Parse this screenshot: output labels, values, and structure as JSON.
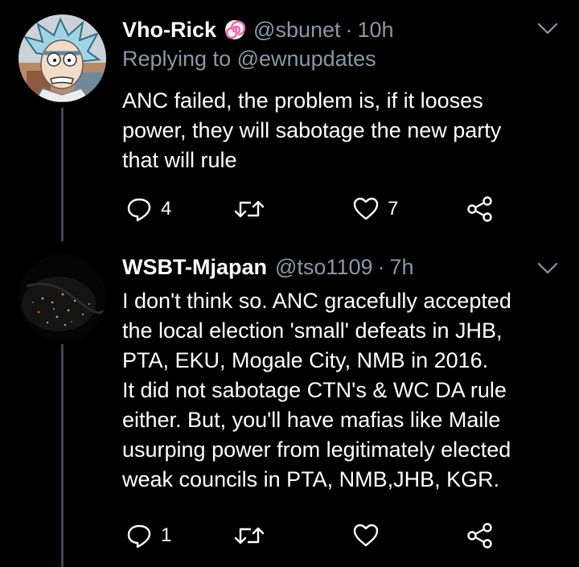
{
  "tweets": [
    {
      "display_name": "Vho-Rick",
      "handle": "@sbunet",
      "separator": "·",
      "time": "10h",
      "verified_badge_icon": "swirl-candy-emoji-icon",
      "avatar_icon": "cartoon-character-avatar",
      "reply_label": "Replying to",
      "reply_target": "@ewnupdates",
      "text_lines": [
        "ANC failed, the problem is, if it looses",
        "power, they will sabotage the new party",
        "that will rule"
      ],
      "actions": {
        "reply_count": "4",
        "retweet_count": "",
        "like_count": "7"
      }
    },
    {
      "display_name": "WSBT-Mjapan",
      "handle": "@tso1109",
      "separator": "·",
      "time": "7h",
      "avatar_icon": "night-city-lights-avatar",
      "text_lines": [
        "I don't think so. ANC gracefully accepted",
        "the local election 'small' defeats in JHB,",
        "PTA, EKU, Mogale City, NMB in 2016.",
        "It did not sabotage CTN's & WC DA rule",
        "either. But, you'll have mafias like Maile",
        "usurping power from legitimately elected",
        "weak councils in PTA, NMB,JHB, KGR."
      ],
      "actions": {
        "reply_count": "1",
        "retweet_count": "",
        "like_count": ""
      }
    }
  ],
  "colors": {
    "background": "#000000",
    "primary_text": "#ffffff",
    "secondary_text": "#8899a6",
    "thread_line": "#3d4650"
  }
}
